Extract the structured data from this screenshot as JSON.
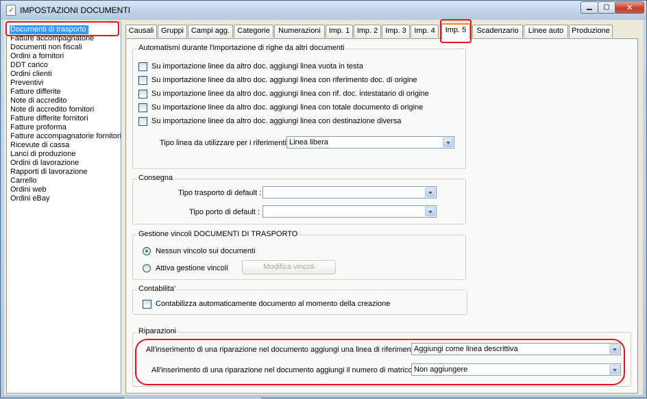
{
  "window": {
    "title": "IMPOSTAZIONI DOCUMENTI",
    "controls": {
      "minimize": "▁",
      "maximize": "▢",
      "close": "✕"
    }
  },
  "doclist": {
    "items": [
      "Documenti di trasporto",
      "Fatture accompagnatorie",
      "Documenti non fiscali",
      "Ordini a fornitori",
      "DDT carico",
      "Ordini clienti",
      "Preventivi",
      "Fatture differite",
      "Note di accredito",
      "Note di accredito fornitori",
      "Fatture differite fornitori",
      "Fatture proforma",
      "Fatture accompagnatorie fornitori",
      "Ricevute di cassa",
      "Lanci di produzione",
      "Ordini di lavorazione",
      "Rapporti di lavorazione",
      "Carrello",
      "Ordini web",
      "Ordini eBay"
    ],
    "selected_index": 0
  },
  "tabs": [
    "Causali",
    "Gruppi",
    "Campi agg.",
    "Categorie",
    "Numerazioni",
    "Imp. 1",
    "Imp. 2",
    "Imp. 3",
    "Imp. 4",
    "Imp. 5",
    "Scadenzario",
    "Linee auto",
    "Produzione"
  ],
  "active_tab_index": 9,
  "automatismi": {
    "title": "Automatismi durante l'importazione di righe da altri documenti",
    "checks": [
      "Su importazione linee da altro doc. aggiungi linea vuota in testa",
      "Su importazione linee da altro doc. aggiungi linea con riferimento doc. di origine",
      "Su importazione linee da altro doc. aggiungi linea con rif. doc. intestatario di origine",
      "Su importazione linee da altro doc. aggiungi linea con totale documento di origine",
      "Su importazione linee da altro doc. aggiungi linea con destinazione diversa"
    ],
    "tipo_linea_label": "Tipo linea da utilizzare per i riferimenti :",
    "tipo_linea_value": "Linea libera"
  },
  "consegna": {
    "title": "Consegna",
    "trasporto_label": "Tipo trasporto di default :",
    "trasporto_value": "",
    "porto_label": "Tipo porto di default :",
    "porto_value": ""
  },
  "vincoli": {
    "title": "Gestione vincoli DOCUMENTI DI TRASPORTO",
    "option_none": "Nessun vincolo sui documenti",
    "option_enable": "Attiva gestione vincoli",
    "selected": "option_none",
    "modify_button": "Modifica vincoli"
  },
  "contabilita": {
    "title": "Contabilita'",
    "check": "Contabilizza automaticamente documento al momento della creazione"
  },
  "riparazioni": {
    "title": "Riparazioni",
    "linea_label": "All'inserimento di una riparazione nel documento aggiungi una linea di riferimento :",
    "linea_value": "Aggiungi come linea descrittiva",
    "matricola_label": "All'inserimento di una riparazione nel documento aggiungi il numero di matricola :",
    "matricola_value": "Non aggiungere"
  },
  "colors": {
    "highlight": "#e8131b",
    "selection": "#3399ff",
    "active_tab_top": "#e68b2c"
  }
}
